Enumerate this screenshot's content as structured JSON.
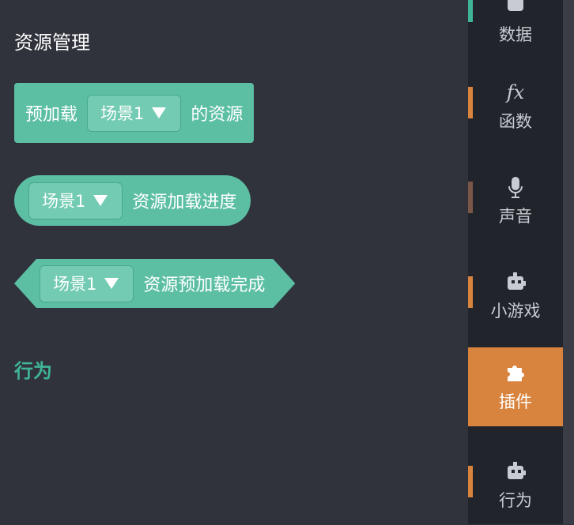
{
  "workspace": {
    "section_title": "资源管理",
    "blocks": [
      {
        "prefix": "预加载",
        "dropdown": "场景1",
        "suffix": "的资源"
      },
      {
        "dropdown": "场景1",
        "suffix": "资源加载进度"
      },
      {
        "dropdown": "场景1",
        "suffix": "资源预加载完成"
      }
    ],
    "behavior_title": "行为"
  },
  "sidebar": {
    "categories": [
      {
        "label": "数据",
        "icon": "data-icon",
        "marker_color": "#3fb596"
      },
      {
        "label": "函数",
        "icon": "fx-icon",
        "icon_text": "fx",
        "marker_color": "#d9843e"
      },
      {
        "label": "声音",
        "icon": "microphone-icon",
        "marker_color": "#7a5748"
      },
      {
        "label": "小游戏",
        "icon": "robot-icon",
        "marker_color": "#d9843e"
      },
      {
        "label": "插件",
        "icon": "puzzle-icon",
        "active": true
      },
      {
        "label": "行为",
        "icon": "robot-icon",
        "marker_color": "#d9843e"
      }
    ]
  },
  "colors": {
    "background": "#30333c",
    "block": "#5cbfa4",
    "block_slot": "#73cbb3",
    "sidebar": "#21242b",
    "active": "#d9843e",
    "behavior_title": "#3fb596"
  }
}
